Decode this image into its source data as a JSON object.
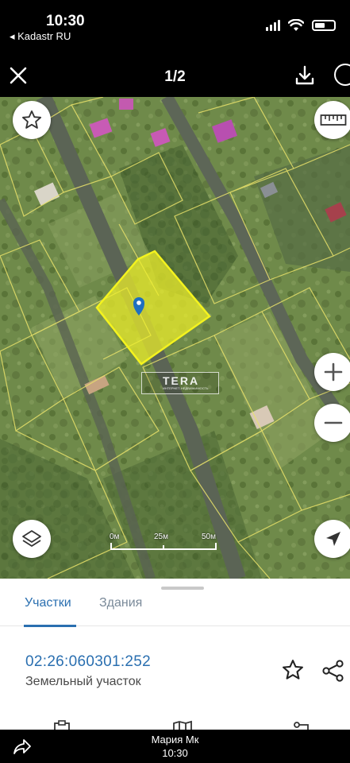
{
  "status_bar": {
    "time": "10:30",
    "back_app": "◂ Kadastr RU",
    "icons": [
      "signal-icon",
      "wifi-icon",
      "battery-icon"
    ]
  },
  "viewer": {
    "counter": "1/2",
    "icons": [
      "close-icon",
      "download-icon",
      "more-icon"
    ]
  },
  "map": {
    "watermark": "TERA",
    "watermark_small": "ИНТЕРНЕТ-НЕДВИЖИМОСТЬ",
    "scale_labels": [
      "0м",
      "25м",
      "50м"
    ],
    "highlight_color": "#eef02a",
    "marker_color": "#1e6fbf",
    "buttons": [
      "favorite-star-icon",
      "ruler-icon",
      "zoom-in-icon",
      "zoom-out-icon",
      "layers-icon",
      "location-arrow-icon"
    ]
  },
  "sheet": {
    "tabs": [
      {
        "label": "Участки",
        "active": true
      },
      {
        "label": "Здания",
        "active": false
      }
    ],
    "cadastral_number": "02:26:060301:252",
    "object_type": "Земельный участок",
    "accent_color": "#2a6fb0"
  },
  "call_bar": {
    "name": "Мария Мк",
    "time": "10:30"
  }
}
